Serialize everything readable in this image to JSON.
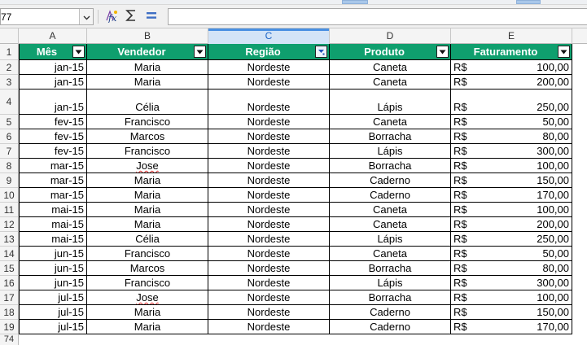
{
  "name_box": "77",
  "formula_value": "",
  "icons": {
    "function_wizard": "function-wizard-icon",
    "sum": "sum-icon",
    "equals": "equals-icon"
  },
  "column_letters": [
    "A",
    "B",
    "C",
    "D",
    "E"
  ],
  "selected_column": "C",
  "header_row": {
    "row_number": "1",
    "cells": [
      "Mês",
      "Vendedor",
      "Região",
      "Produto",
      "Faturamento"
    ]
  },
  "currency_symbol": "R$",
  "rows": [
    {
      "row": "2",
      "mes": "jan-15",
      "vendedor": "Maria",
      "regiao": "Nordeste",
      "produto": "Caneta",
      "faturamento": "100,00"
    },
    {
      "row": "3",
      "mes": "jan-15",
      "vendedor": "Maria",
      "regiao": "Nordeste",
      "produto": "Caneta",
      "faturamento": "200,00"
    },
    {
      "row": "4",
      "mes": "jan-15",
      "vendedor": "Célia",
      "regiao": "Nordeste",
      "produto": "Lápis",
      "faturamento": "250,00"
    },
    {
      "row": "5",
      "mes": "fev-15",
      "vendedor": "Francisco",
      "regiao": "Nordeste",
      "produto": "Caneta",
      "faturamento": "50,00"
    },
    {
      "row": "6",
      "mes": "fev-15",
      "vendedor": "Marcos",
      "regiao": "Nordeste",
      "produto": "Borracha",
      "faturamento": "80,00"
    },
    {
      "row": "7",
      "mes": "fev-15",
      "vendedor": "Francisco",
      "regiao": "Nordeste",
      "produto": "Lápis",
      "faturamento": "300,00"
    },
    {
      "row": "8",
      "mes": "mar-15",
      "vendedor": "Jose",
      "regiao": "Nordeste",
      "produto": "Borracha",
      "faturamento": "100,00"
    },
    {
      "row": "9",
      "mes": "mar-15",
      "vendedor": "Maria",
      "regiao": "Nordeste",
      "produto": "Caderno",
      "faturamento": "150,00"
    },
    {
      "row": "10",
      "mes": "mar-15",
      "vendedor": "Maria",
      "regiao": "Nordeste",
      "produto": "Caderno",
      "faturamento": "170,00"
    },
    {
      "row": "11",
      "mes": "mai-15",
      "vendedor": "Maria",
      "regiao": "Nordeste",
      "produto": "Caneta",
      "faturamento": "100,00"
    },
    {
      "row": "12",
      "mes": "mai-15",
      "vendedor": "Maria",
      "regiao": "Nordeste",
      "produto": "Caneta",
      "faturamento": "200,00"
    },
    {
      "row": "13",
      "mes": "mai-15",
      "vendedor": "Célia",
      "regiao": "Nordeste",
      "produto": "Lápis",
      "faturamento": "250,00"
    },
    {
      "row": "14",
      "mes": "jun-15",
      "vendedor": "Francisco",
      "regiao": "Nordeste",
      "produto": "Caneta",
      "faturamento": "50,00"
    },
    {
      "row": "15",
      "mes": "jun-15",
      "vendedor": "Marcos",
      "regiao": "Nordeste",
      "produto": "Borracha",
      "faturamento": "80,00"
    },
    {
      "row": "16",
      "mes": "jun-15",
      "vendedor": "Francisco",
      "regiao": "Nordeste",
      "produto": "Lápis",
      "faturamento": "300,00"
    },
    {
      "row": "17",
      "mes": "jul-15",
      "vendedor": "Jose",
      "regiao": "Nordeste",
      "produto": "Borracha",
      "faturamento": "100,00"
    },
    {
      "row": "18",
      "mes": "jul-15",
      "vendedor": "Maria",
      "regiao": "Nordeste",
      "produto": "Caderno",
      "faturamento": "150,00"
    },
    {
      "row": "19",
      "mes": "jul-15",
      "vendedor": "Maria",
      "regiao": "Nordeste",
      "produto": "Caderno",
      "faturamento": "170,00"
    }
  ],
  "trailing_row_number": "74",
  "colors": {
    "header_fill": "#0f9f6e",
    "header_text": "#ffffff",
    "selected_column_fill": "#d4e4f7",
    "spellcheck_underline": "#e03131"
  }
}
